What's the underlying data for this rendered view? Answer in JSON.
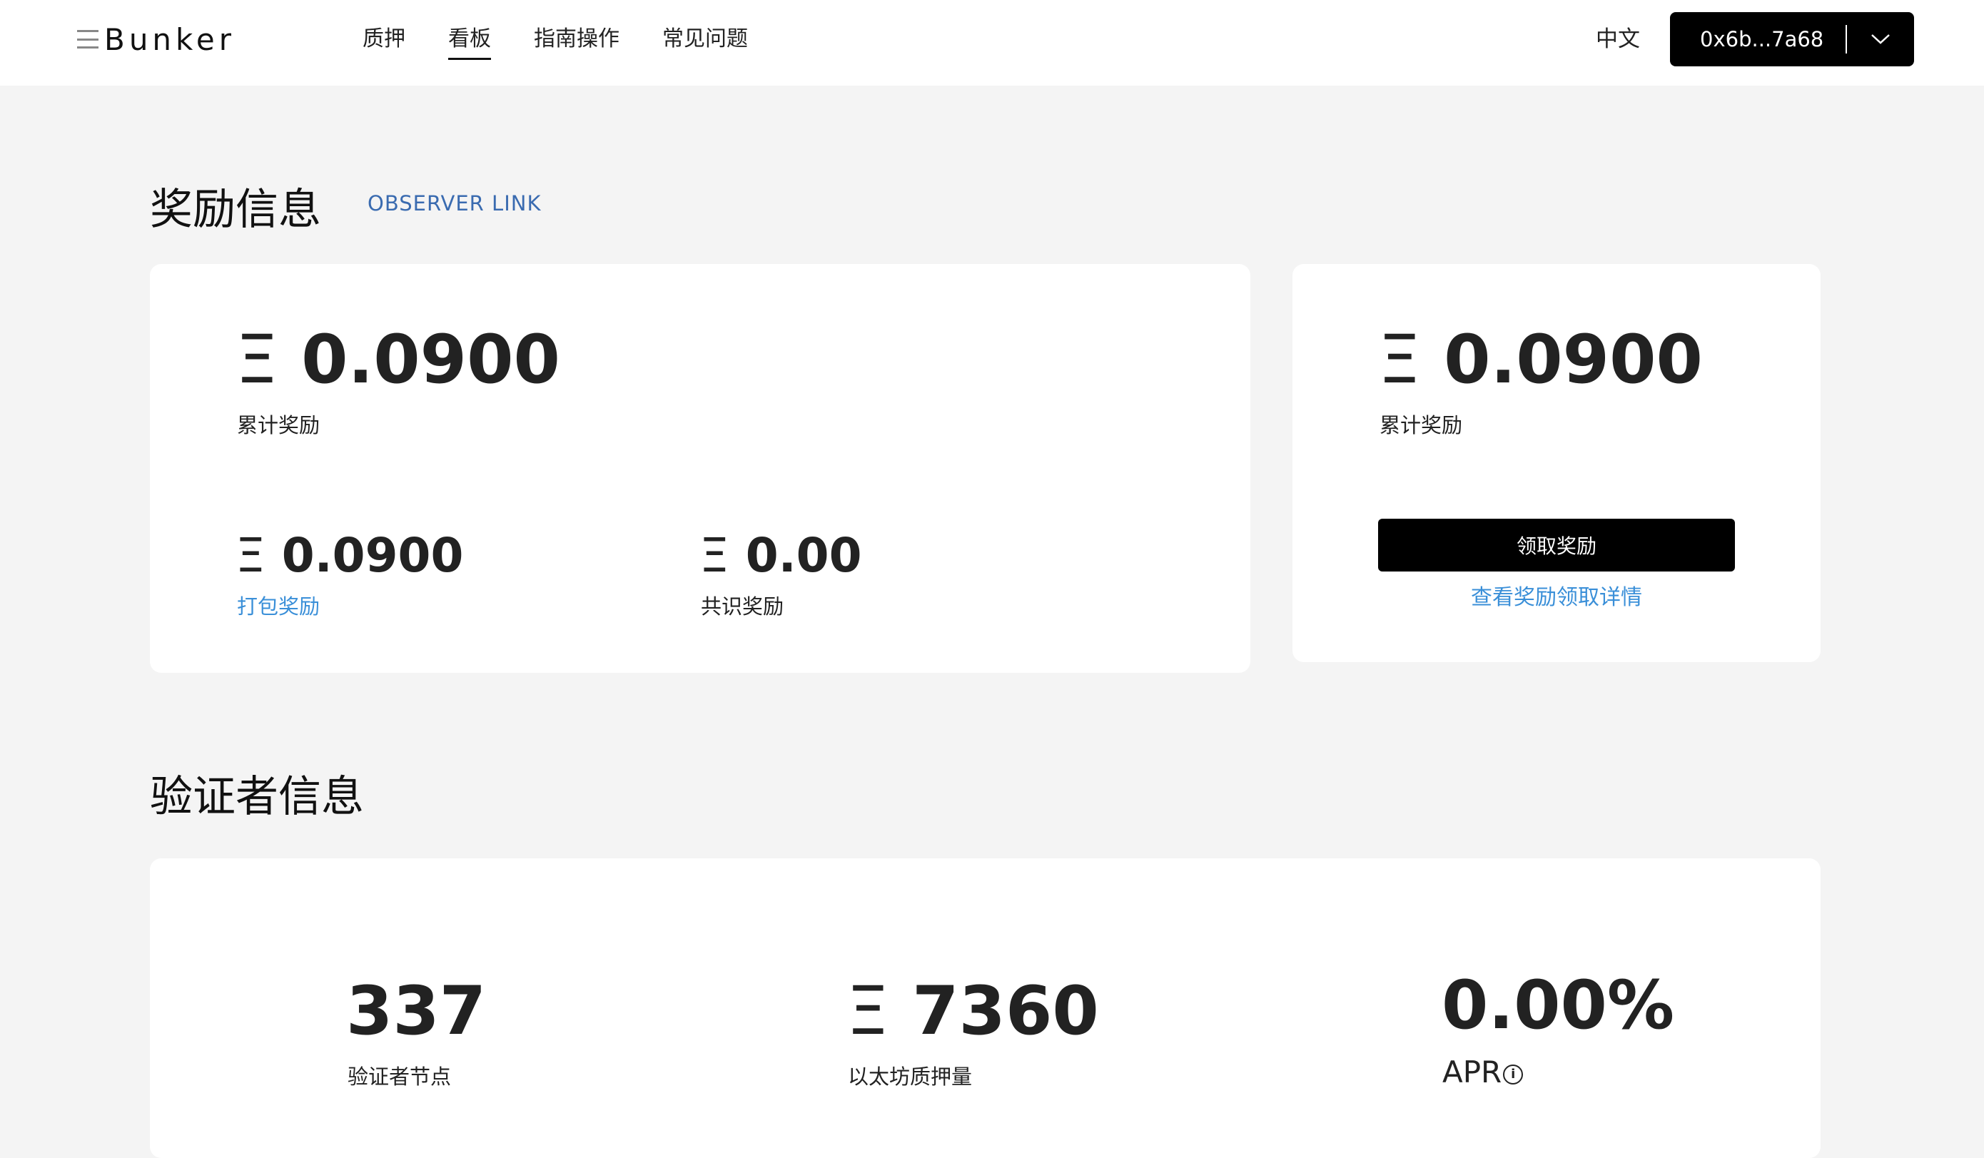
{
  "header": {
    "logo_text": "Bunker",
    "nav": [
      {
        "label": "质押",
        "active": false
      },
      {
        "label": "看板",
        "active": true
      },
      {
        "label": "指南操作",
        "active": false
      },
      {
        "label": "常见问题",
        "active": false
      }
    ],
    "language": "中文",
    "wallet_address": "0x6b...7a68"
  },
  "rewards": {
    "title": "奖励信息",
    "observer_link": "OBSERVER LINK",
    "currency_symbol": "Ξ",
    "total": {
      "value": "0.0900",
      "label": "累计奖励"
    },
    "packaging": {
      "value": "0.0900",
      "label": "打包奖励"
    },
    "consensus": {
      "value": "0.00",
      "label": "共识奖励"
    },
    "claim_panel": {
      "value": "0.0900",
      "label": "累计奖励",
      "claim_button": "领取奖励",
      "details_link": "查看奖励领取详情"
    }
  },
  "validators": {
    "title": "验证者信息",
    "nodes": {
      "value": "337",
      "label": "验证者节点"
    },
    "staked": {
      "symbol": "Ξ",
      "value": "7360",
      "label": "以太坊质押量"
    },
    "apr": {
      "value": "0.00%",
      "label": "APR",
      "info_icon": "info-icon"
    }
  },
  "colors": {
    "background": "#f4f4f4",
    "link_blue": "#3a8fd8",
    "observer_blue": "#3a6bb0",
    "button_black": "#000000"
  }
}
